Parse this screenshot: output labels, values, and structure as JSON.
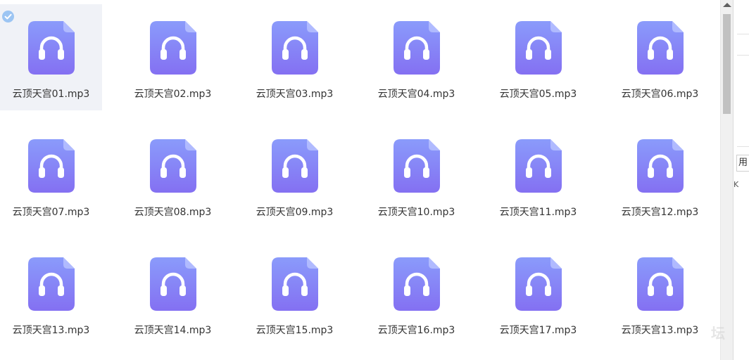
{
  "files": [
    {
      "name": "云顶天宫01.mp3",
      "selected": true
    },
    {
      "name": "云顶天宫02.mp3",
      "selected": false
    },
    {
      "name": "云顶天宫03.mp3",
      "selected": false
    },
    {
      "name": "云顶天宫04.mp3",
      "selected": false
    },
    {
      "name": "云顶天宫05.mp3",
      "selected": false
    },
    {
      "name": "云顶天宫06.mp3",
      "selected": false
    },
    {
      "name": "云顶天宫07.mp3",
      "selected": false
    },
    {
      "name": "云顶天宫08.mp3",
      "selected": false
    },
    {
      "name": "云顶天宫09.mp3",
      "selected": false
    },
    {
      "name": "云顶天宫10.mp3",
      "selected": false
    },
    {
      "name": "云顶天宫11.mp3",
      "selected": false
    },
    {
      "name": "云顶天宫12.mp3",
      "selected": false
    },
    {
      "name": "云顶天宫13.mp3",
      "selected": false
    },
    {
      "name": "云顶天宫14.mp3",
      "selected": false
    },
    {
      "name": "云顶天宫15.mp3",
      "selected": false
    },
    {
      "name": "云顶天宫16.mp3",
      "selected": false
    },
    {
      "name": "云顶天宫17.mp3",
      "selected": false
    },
    {
      "name": "云顶天宫13.mp3",
      "selected": false
    }
  ],
  "icons": {
    "file": "audio-file-icon",
    "check": "check-circle-icon"
  },
  "colors": {
    "icon_gradient_top": "#8a9bfb",
    "icon_gradient_bottom": "#8470f2",
    "check_badge": "#9cc5f3",
    "selected_bg": "#f0f2f7"
  },
  "background_window": {
    "button_label": "用",
    "mark": "K",
    "watermark": "坛"
  }
}
